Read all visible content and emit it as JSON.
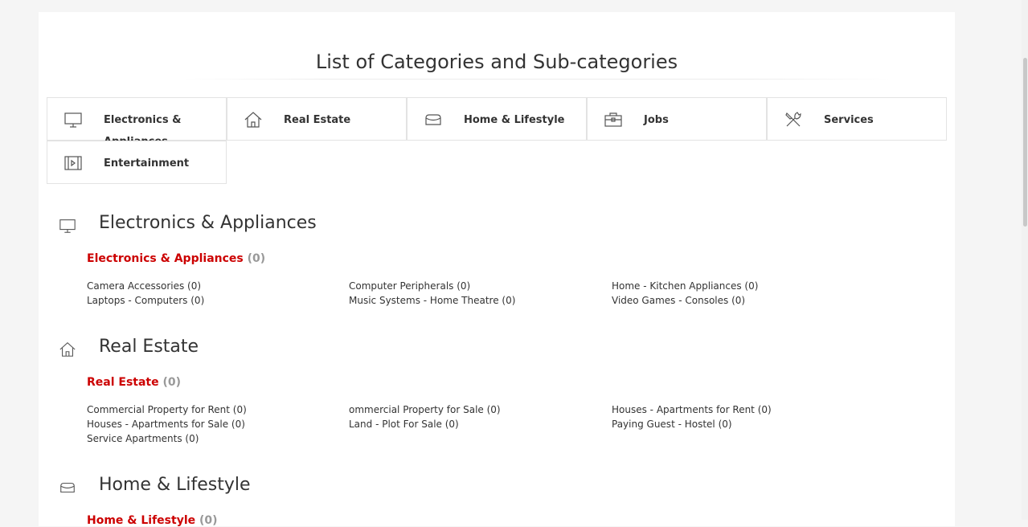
{
  "page": {
    "title": "List of Categories and Sub-categories"
  },
  "colors": {
    "accent": "#cc0000",
    "count": "#999999",
    "text": "#333333",
    "border": "#e3e3e3"
  },
  "tiles": [
    {
      "label": "Electronics & Appliances",
      "icon": "monitor-icon"
    },
    {
      "label": "Real Estate",
      "icon": "house-icon"
    },
    {
      "label": "Home & Lifestyle",
      "icon": "sofa-icon"
    },
    {
      "label": "Jobs",
      "icon": "briefcase-icon"
    },
    {
      "label": "Services",
      "icon": "tools-icon"
    },
    {
      "label": "Entertainment",
      "icon": "film-icon"
    }
  ],
  "sections": [
    {
      "title": "Electronics & Appliances",
      "icon": "monitor-icon",
      "subhead": {
        "name": "Electronics & Appliances",
        "count": "(0)"
      },
      "items": [
        "Camera Accessories (0)",
        "Computer Peripherals (0)",
        "Home - Kitchen Appliances (0)",
        "Laptops - Computers (0)",
        "Music Systems - Home Theatre (0)",
        "Video Games - Consoles (0)"
      ]
    },
    {
      "title": "Real Estate",
      "icon": "house-icon",
      "subhead": {
        "name": "Real Estate",
        "count": "(0)"
      },
      "items": [
        "Commercial Property for Rent (0)",
        "ommercial Property for Sale (0)",
        "Houses - Apartments for Rent (0)",
        "Houses - Apartments for Sale (0)",
        "Land - Plot For Sale (0)",
        "Paying Guest - Hostel (0)",
        "Service Apartments (0)"
      ]
    },
    {
      "title": "Home & Lifestyle",
      "icon": "sofa-icon",
      "subhead": {
        "name": "Home & Lifestyle",
        "count": "(0)"
      }
    }
  ]
}
